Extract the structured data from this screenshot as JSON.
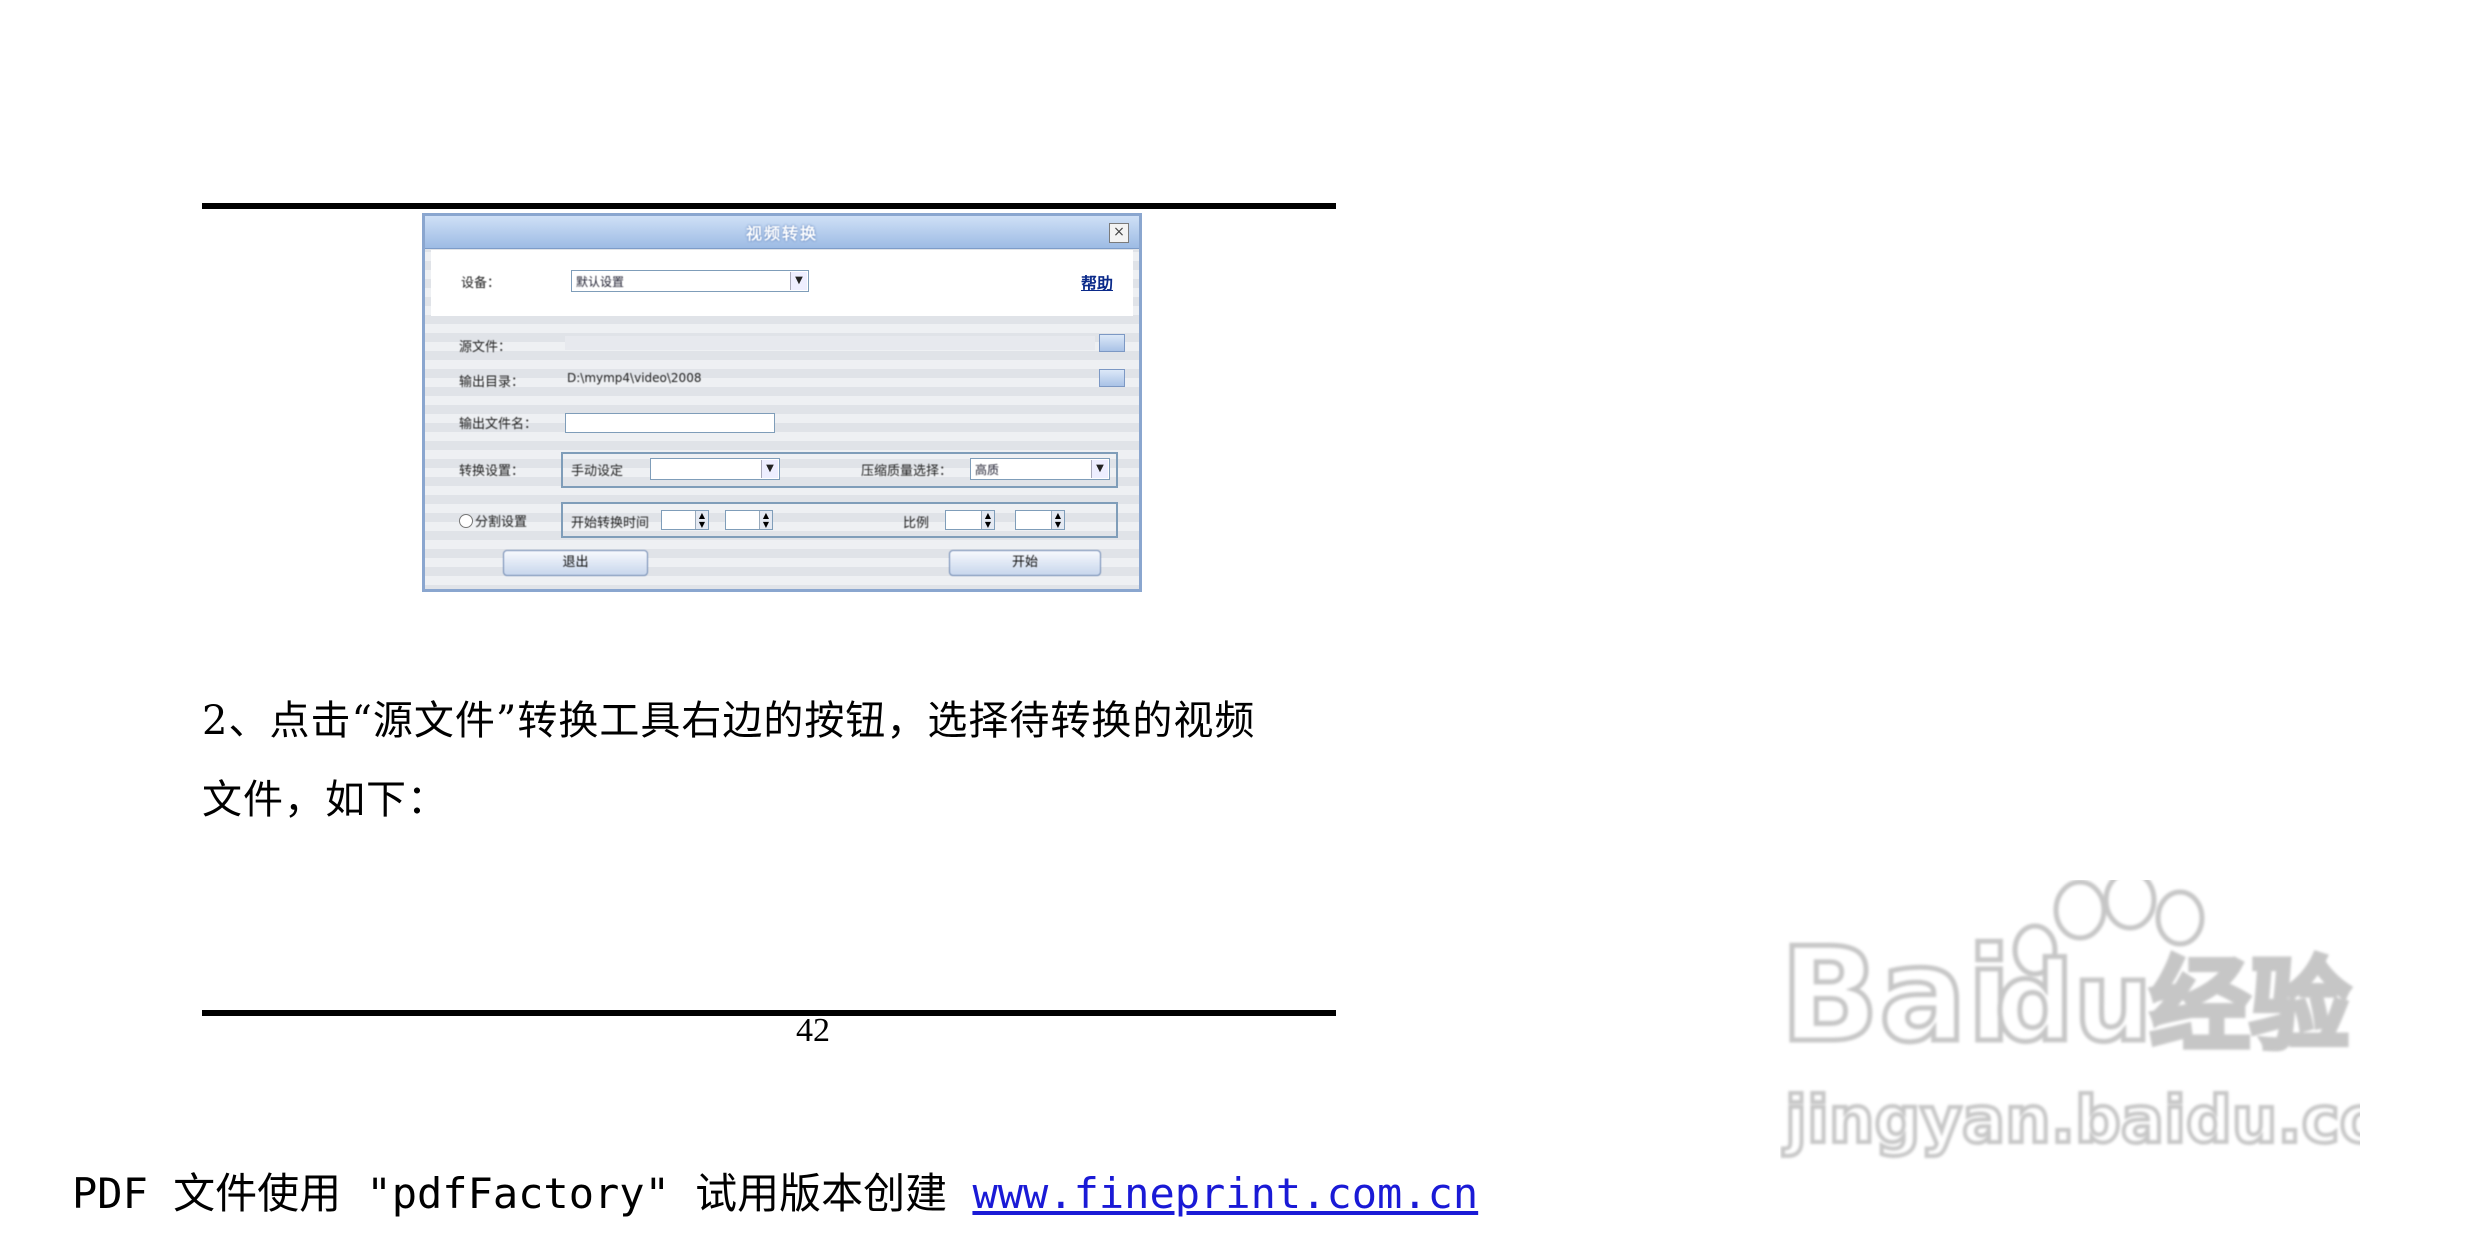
{
  "dialog": {
    "title": "视频转换",
    "close_label": "×",
    "device_label": "设备：",
    "device_value": "默认设置",
    "help_link": "帮助",
    "source_label": "源文件：",
    "output_dir_label": "输出目录：",
    "output_dir_value": "D:\\mymp4\\video\\2008",
    "output_name_label": "输出文件名：",
    "convert_label": "转换设置：",
    "convert_value": "手动设定",
    "quality_label": "压缩质量选择：",
    "quality_value": "高质",
    "cut_label": "分割设置",
    "cut_start_label": "开始转换时间",
    "ratio_label": "比例",
    "exit_button": "退出",
    "start_button": "开始"
  },
  "body": {
    "line1": "2、点击“源文件”转换工具右边的按钮，选择待转换的视频",
    "line2": "文件，如下："
  },
  "page_number": "42",
  "footer": {
    "text": "PDF 文件使用 \"pdfFactory\" 试用版本创建 ",
    "link": "www.fineprint.com.cn"
  },
  "watermark": {
    "brand": "Bai",
    "brand_tail": "du",
    "cn": "经验",
    "url": "jingyan.baidu.com"
  }
}
